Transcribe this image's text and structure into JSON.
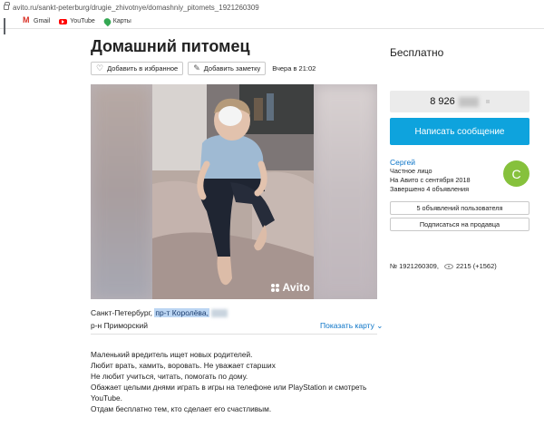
{
  "browser": {
    "url": "avito.ru/sankt-peterburg/drugie_zhivotnye/domashniy_pitomets_1921260309",
    "bookmarks": [
      {
        "icon": "apps-icon",
        "label": ""
      },
      {
        "icon": "gmail-icon",
        "label": "Gmail"
      },
      {
        "icon": "youtube-icon",
        "label": "YouTube"
      },
      {
        "icon": "maps-icon",
        "label": "Карты"
      }
    ]
  },
  "listing": {
    "title": "Домашний питомец",
    "favorite_label": "Добавить в избранное",
    "note_label": "Добавить заметку",
    "date": "Вчера в 21:02",
    "watermark": "Avito",
    "address_city": "Санкт-Петербург,",
    "address_street": "пр-т Королёва,",
    "district": "р-н Приморский",
    "show_map": "Показать карту",
    "description": [
      "Маленький вредитель ищет новых родителей.",
      "Любит врать, хамить, воровать. Не уважает старших",
      "Не любит учиться, читать, помогать по дому.",
      "Обажает целыми днями играть в игры на телефоне или PlayStation и смотреть YouTube.",
      "Отдам бесплатно тем, кто сделает его счастливым."
    ]
  },
  "sidebar": {
    "price": "Бесплатно",
    "phone": "8 926",
    "message_button": "Написать сообщение",
    "seller_name": "Сергей",
    "seller_type": "Частное лицо",
    "seller_since": "На Авито с сентября 2018",
    "seller_completed": "Завершено 4 объявления",
    "avatar_letter": "С",
    "ads_button": "5 объявлений пользователя",
    "subscribe_button": "Подписаться на продавца",
    "ad_number": "№ 1921260309,",
    "views": "2215 (+1562)"
  },
  "colors": {
    "accent_blue": "#0ea3dd",
    "link_blue": "#0b74c7",
    "avatar_green": "#86c13c",
    "phone_bg": "#ebebeb"
  }
}
